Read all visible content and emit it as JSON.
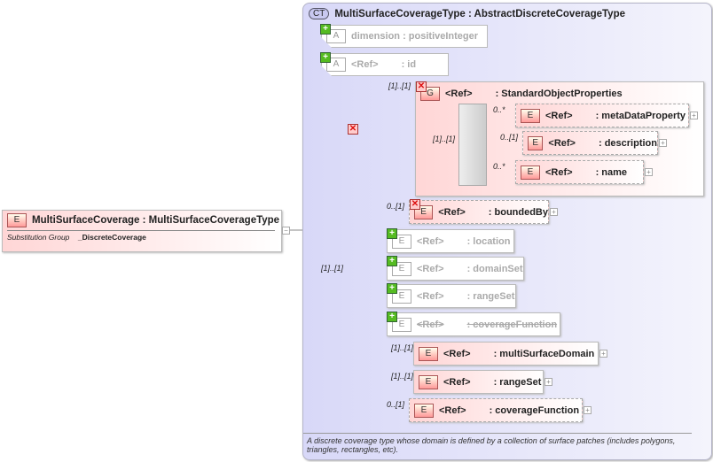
{
  "element": {
    "tag": "E",
    "name": "MultiSurfaceCoverage",
    "type": ": MultiSurfaceCoverageType",
    "subst_label": "Substitution Group",
    "subst_value": "_DiscreteCoverage"
  },
  "complex_type": {
    "badge": "CT",
    "title": "MultiSurfaceCoverageType : AbstractDiscreteCoverageType",
    "description": "A discrete coverage type whose domain is defined by a collection of surface patches (includes polygons, triangles, rectangles, etc)."
  },
  "attributes": [
    {
      "tag": "A",
      "name": "dimension",
      "type": ": positiveInteger"
    },
    {
      "tag": "A",
      "name": "<Ref>",
      "type": ": id"
    }
  ],
  "group": {
    "tag": "G",
    "cardinality": "[1]..[1]",
    "name": "<Ref>",
    "type": ": StandardObjectProperties",
    "seq_cardinality": "[1]..[1]",
    "children": [
      {
        "card": "0..*",
        "name": "<Ref>",
        "type": ": metaDataProperty"
      },
      {
        "card": "0..[1]",
        "name": "<Ref>",
        "type": ": description"
      },
      {
        "card": "0..*",
        "name": "<Ref>",
        "type": ": name"
      }
    ]
  },
  "sequence_cardinality": "[1]..[1]",
  "children": [
    {
      "card": "0..[1]",
      "name": "<Ref>",
      "type": ": boundedBy"
    },
    {
      "card": "",
      "name": "<Ref>",
      "type": ": location"
    },
    {
      "card": "",
      "name": "<Ref>",
      "type": ": domainSet"
    },
    {
      "card": "",
      "name": "<Ref>",
      "type": ": rangeSet"
    },
    {
      "card": "",
      "name": "<Ref>",
      "type": ": coverageFunction"
    },
    {
      "card": "[1]..[1]",
      "name": "<Ref>",
      "type": ": multiSurfaceDomain"
    },
    {
      "card": "[1]..[1]",
      "name": "<Ref>",
      "type": ": rangeSet"
    },
    {
      "card": "0..[1]",
      "name": "<Ref>",
      "type": ": coverageFunction"
    }
  ],
  "tags": {
    "element": "E"
  }
}
